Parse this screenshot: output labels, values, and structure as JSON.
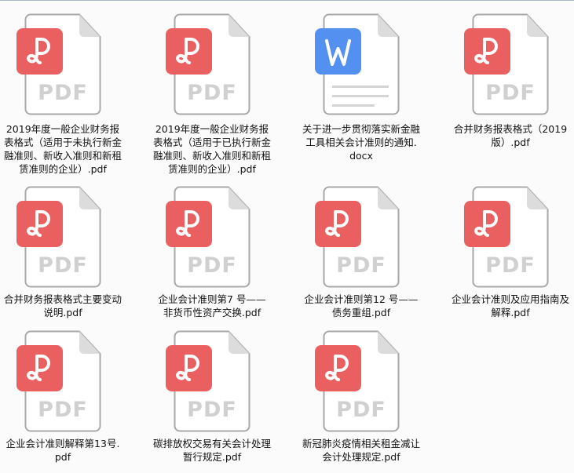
{
  "colors": {
    "pdf": "#ea5f5f",
    "word": "#5390ef",
    "page_text": "#d0d0d0"
  },
  "files": [
    {
      "type": "pdf",
      "icon": "pdf-file-icon",
      "lines": [
        "2019年度一般企业财务报",
        "表格式（适用于未执行新金",
        "融准则、新收入准则和新租",
        "赁准则的企业）.pdf"
      ]
    },
    {
      "type": "pdf",
      "icon": "pdf-file-icon",
      "lines": [
        "2019年度一般企业财务报",
        "表格式（适用于已执行新金",
        "融准则、新收入准则和新租",
        "赁准则的企业）.pdf"
      ]
    },
    {
      "type": "docx",
      "icon": "word-file-icon",
      "lines": [
        "关于进一步贯彻落实新金融",
        "工具相关会计准则的通知.",
        "docx"
      ]
    },
    {
      "type": "pdf",
      "icon": "pdf-file-icon",
      "lines": [
        "合并财务报表格式（2019",
        "版）.pdf"
      ]
    },
    {
      "type": "pdf",
      "icon": "pdf-file-icon",
      "lines": [
        "合并财务报表格式主要变动",
        "说明.pdf"
      ]
    },
    {
      "type": "pdf",
      "icon": "pdf-file-icon",
      "lines": [
        "企业会计准则第7 号——",
        "非货币性资产交换.pdf"
      ]
    },
    {
      "type": "pdf",
      "icon": "pdf-file-icon",
      "lines": [
        "企业会计准则第12 号——",
        "债务重组.pdf"
      ]
    },
    {
      "type": "pdf",
      "icon": "pdf-file-icon",
      "lines": [
        "企业会计准则及应用指南及",
        "解释.pdf"
      ]
    },
    {
      "type": "pdf",
      "icon": "pdf-file-icon",
      "lines": [
        "企业会计准则解释第13号.",
        "pdf"
      ]
    },
    {
      "type": "pdf",
      "icon": "pdf-file-icon",
      "lines": [
        "碳排放权交易有关会计处理",
        "暂行规定.pdf"
      ]
    },
    {
      "type": "pdf",
      "icon": "pdf-file-icon",
      "lines": [
        "新冠肺炎疫情相关租金减让",
        "会计处理规定.pdf"
      ]
    }
  ],
  "pdf_badge_text": "PDF"
}
